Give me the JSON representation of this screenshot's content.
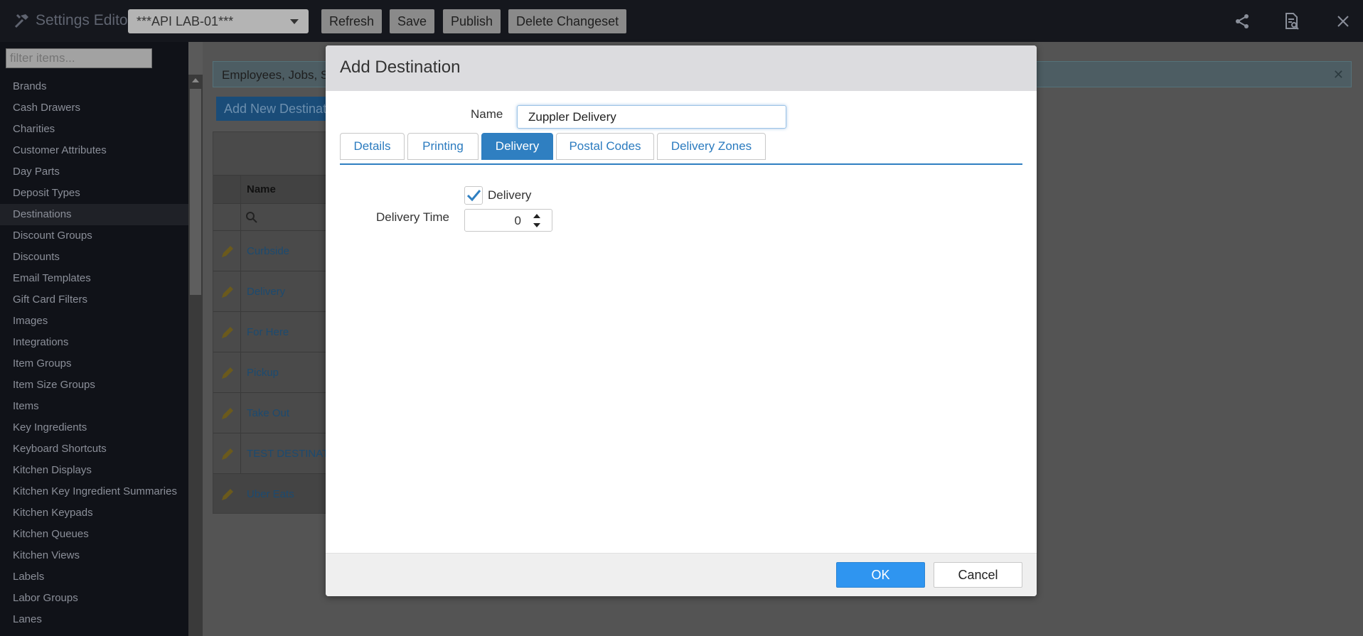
{
  "header": {
    "app_title": "Settings Editor",
    "environment": "***API LAB-01***",
    "buttons": {
      "refresh": "Refresh",
      "save": "Save",
      "publish": "Publish",
      "delete_changeset": "Delete Changeset"
    },
    "icons": [
      "share-icon",
      "document-search-icon",
      "close-icon"
    ]
  },
  "sidebar": {
    "filter_placeholder": "filter items...",
    "active": "Destinations",
    "items": [
      "Brands",
      "Cash Drawers",
      "Charities",
      "Customer Attributes",
      "Day Parts",
      "Deposit Types",
      "Destinations",
      "Discount Groups",
      "Discounts",
      "Email Templates",
      "Gift Card Filters",
      "Images",
      "Integrations",
      "Item Groups",
      "Item Size Groups",
      "Items",
      "Key Ingredients",
      "Keyboard Shortcuts",
      "Kitchen Displays",
      "Kitchen Key Ingredient Summaries",
      "Kitchen Keypads",
      "Kitchen Queues",
      "Kitchen Views",
      "Labels",
      "Labor Groups",
      "Lanes"
    ]
  },
  "background": {
    "info_bar": "Employees, Jobs, Se",
    "add_button": "Add New Destinati",
    "grid_header": "Name",
    "rows": [
      "Curbside",
      "Delivery",
      "For Here",
      "Pickup",
      "Take Out",
      "TEST DESTINATIO",
      "Uber Eats"
    ]
  },
  "modal": {
    "title": "Add Destination",
    "name_label": "Name",
    "name_value": "Zuppler Delivery",
    "tabs": [
      "Details",
      "Printing",
      "Delivery",
      "Postal Codes",
      "Delivery Zones"
    ],
    "active_tab": "Delivery",
    "delivery_checkbox_label": "Delivery",
    "delivery_checked": true,
    "delivery_time_label": "Delivery Time",
    "delivery_time_value": "0",
    "ok": "OK",
    "cancel": "Cancel"
  },
  "colors": {
    "accent": "#2f7fc1",
    "ok": "#2f95f0",
    "topbar": "#15171d",
    "sidebar": "#101218"
  }
}
